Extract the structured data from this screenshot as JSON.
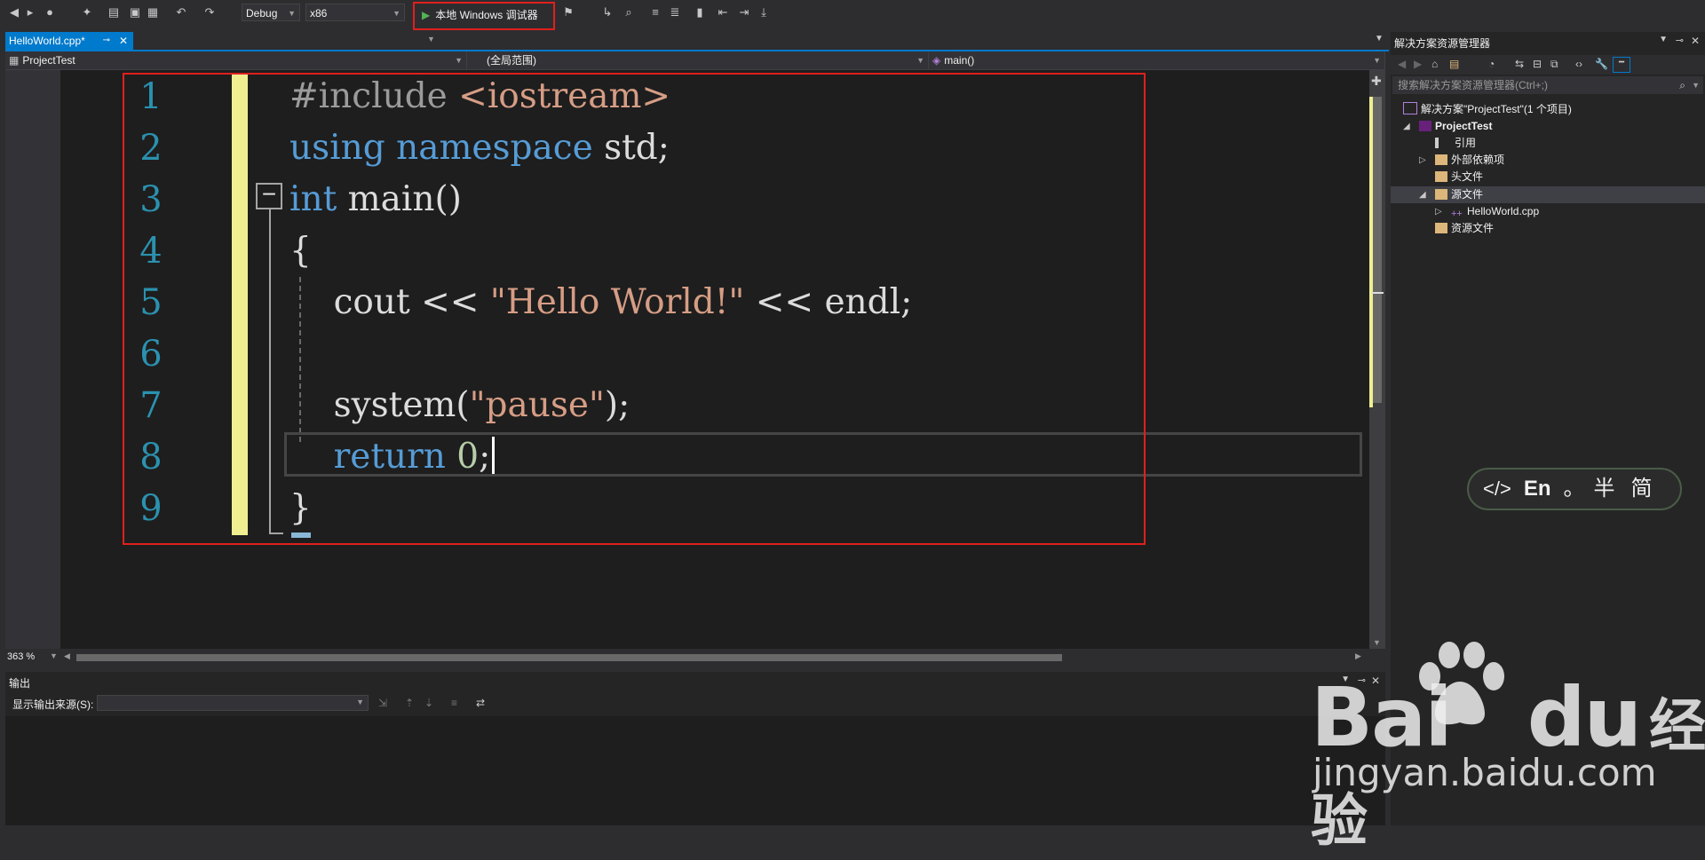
{
  "toolbar": {
    "config": "Debug",
    "platform": "x86",
    "run_label": "本地 Windows 调试器",
    "icons": [
      "back-icon",
      "forward-icon",
      "new-project-icon",
      "open-icon",
      "save-icon",
      "save-all-icon",
      "undo-icon",
      "redo-icon",
      "start-debug-icon",
      "attach-icon",
      "find-icon",
      "bookmark-icon"
    ]
  },
  "tabs": [
    {
      "label": "HelloWorld.cpp*",
      "active": true
    }
  ],
  "navbar": {
    "project": "ProjectTest",
    "scope": "(全局范围)",
    "member": "main()"
  },
  "editor": {
    "line_numbers": [
      "1",
      "2",
      "3",
      "4",
      "5",
      "6",
      "7",
      "8",
      "9"
    ],
    "zoom": "363 %"
  },
  "output": {
    "title": "输出",
    "source_label": "显示输出来源(S):"
  },
  "solution_explorer": {
    "title": "解决方案资源管理器",
    "search_placeholder": "搜索解决方案资源管理器(Ctrl+;)",
    "items": [
      {
        "label": "解决方案\"ProjectTest\"(1 个项目)"
      },
      {
        "label": "ProjectTest"
      },
      {
        "label": "引用"
      },
      {
        "label": "外部依赖项"
      },
      {
        "label": "头文件"
      },
      {
        "label": "源文件"
      },
      {
        "label": "HelloWorld.cpp"
      },
      {
        "label": "资源文件"
      }
    ]
  },
  "ime": {
    "label": "En",
    "dot": "。",
    "half": "半",
    "simp": "简"
  },
  "watermark": {
    "brand": "Bai",
    "brand_suffix": "du",
    "cn": "经验",
    "url": "jingyan.baidu.com"
  },
  "colors": {
    "accent": "#007acc",
    "highlight_box": "#e0201e",
    "keyword": "#569cd6",
    "string": "#d69d85",
    "line_number": "#2b91af",
    "change_marker": "#efef91"
  }
}
